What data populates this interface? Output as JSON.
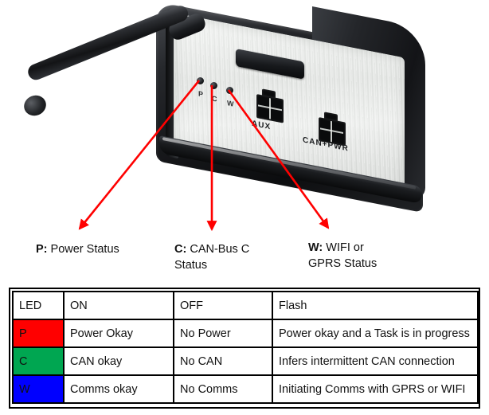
{
  "photo": {
    "alt_name": "telematics-device-photo",
    "device": {
      "antenna_name": "rubber-antenna",
      "display_slot_name": "display-slot",
      "leds": [
        {
          "key": "P",
          "silkscreen": "P"
        },
        {
          "key": "C",
          "silkscreen": "C"
        },
        {
          "key": "W",
          "silkscreen": "W"
        }
      ],
      "connectors": [
        {
          "label": "AUX"
        },
        {
          "label": "CAN+PWR"
        }
      ]
    },
    "arrow_color": "#FF0000"
  },
  "captions": [
    {
      "key": "P:",
      "line1": " Power Status",
      "line2": ""
    },
    {
      "key": "C:",
      "line1": " CAN-Bus C",
      "line2": "Status"
    },
    {
      "key": "W:",
      "line1": " WIFI or",
      "line2": "GPRS Status"
    }
  ],
  "table": {
    "headers": [
      "LED",
      "ON",
      "OFF",
      "Flash"
    ],
    "rows": [
      {
        "led": "P",
        "color": "#FF0000",
        "on": "Power Okay",
        "off": "No Power",
        "flash": "Power okay and a Task is in progress"
      },
      {
        "led": "C",
        "color": "#00A651",
        "on": "CAN okay",
        "off": "No CAN",
        "flash": "Infers intermittent CAN connection"
      },
      {
        "led": "W",
        "color": "#0000FF",
        "on": "Comms okay",
        "off": "No Comms",
        "flash": "Initiating Comms with GPRS or WIFI"
      }
    ]
  }
}
